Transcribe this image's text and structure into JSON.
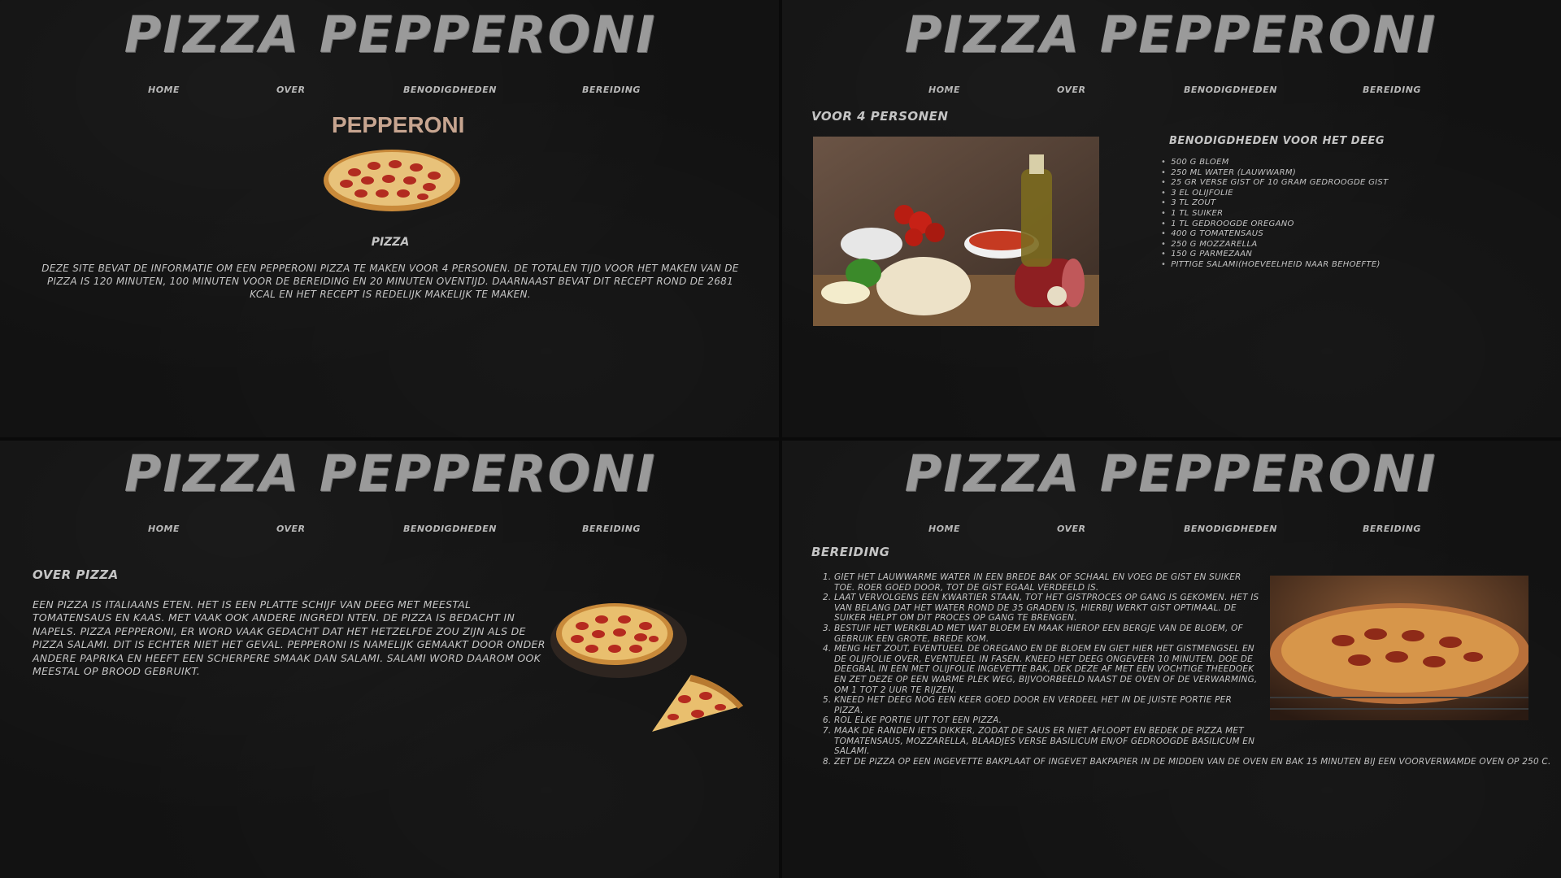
{
  "site": {
    "title": "PIZZA PEPPERONI",
    "nav": [
      "HOME",
      "OVER",
      "BENODIGDHEDEN",
      "BEREIDING"
    ]
  },
  "home": {
    "logo_text": "PEPPERONI",
    "caption": "PIZZA",
    "intro": "DEZE SITE BEVAT DE INFORMATIE OM EEN PEPPERONI PIZZA TE MAKEN VOOR 4 PERSONEN. DE TOTALEN TIJD VOOR HET MAKEN VAN DE PIZZA IS 120 MINUTEN, 100 MINUTEN VOOR DE BEREIDING EN 20 MINUTEN OVENTIJD. DAARNAAST BEVAT DIT RECEPT ROND DE 2681 KCAL EN HET RECEPT IS REDELIJK MAKELIJK TE MAKEN."
  },
  "benodigdheden": {
    "persons": "VOOR 4 PERSONEN",
    "list_title": "BENODIGDHEDEN VOOR HET DEEG",
    "items": [
      "500 G BLOEM",
      "250 ML WATER (LAUWWARM)",
      "25 GR VERSE GIST OF 10 GRAM GEDROOGDE GIST",
      "3 EL OLIJFOLIE",
      "3 TL ZOUT",
      "1 TL SUIKER",
      "1 TL GEDROOGDE OREGANO",
      "400 G TOMATENSAUS",
      "250 G MOZZARELLA",
      "150 G PARMEZAAN",
      "PITTIGE SALAMI(HOEVEELHEID NAAR BEHOEFTE)"
    ]
  },
  "over": {
    "heading": "OVER PIZZA",
    "text": "EEN PIZZA IS ITALIAANS ETEN. HET IS EEN PLATTE SCHIJF VAN DEEG MET MEESTAL TOMATENSAUS EN KAAS. MET VAAK OOK ANDERE INGREDI NTEN. DE PIZZA IS BEDACHT IN NAPELS. PIZZA PEPPERONI, ER WORD VAAK GEDACHT DAT HET HETZELFDE ZOU ZIJN ALS DE PIZZA SALAMI. DIT IS ECHTER NIET HET GEVAL. PEPPERONI IS NAMELIJK GEMAAKT DOOR ONDER ANDERE PAPRIKA EN HEEFT EEN SCHERPERE SMAAK DAN SALAMI. SALAMI WORD DAAROM OOK MEESTAL OP BROOD GEBRUIKT."
  },
  "bereiding": {
    "heading": "BEREIDING",
    "steps": [
      "GIET HET LAUWWARME WATER IN EEN BREDE BAK OF SCHAAL EN VOEG DE GIST EN SUIKER TOE. ROER GOED DOOR, TOT DE GIST EGAAL VERDEELD IS.",
      "LAAT VERVOLGENS EEN KWARTIER STAAN, TOT HET GISTPROCES OP GANG IS GEKOMEN. HET IS VAN BELANG DAT HET WATER ROND DE 35 GRADEN IS, HIERBIJ WERKT GIST OPTIMAAL. DE SUIKER HELPT OM DIT PROCES OP GANG TE BRENGEN.",
      "BESTUIF HET WERKBLAD MET WAT BLOEM EN MAAK HIEROP EEN BERGJE VAN DE BLOEM, OF GEBRUIK EEN GROTE, BREDE KOM.",
      "MENG HET ZOUT, EVENTUEEL DE OREGANO EN DE BLOEM EN GIET HIER HET GISTMENGSEL EN DE OLIJFOLIE OVER, EVENTUEEL IN FASEN. KNEED HET DEEG ONGEVEER 10 MINUTEN. DOE DE DEEGBAL IN EEN MET OLIJFOLIE INGEVETTE BAK, DEK DEZE AF MET EEN VOCHTIGE THEEDOEK EN ZET DEZE OP EEN WARME PLEK WEG, BIJVOORBEELD NAAST DE OVEN OF DE VERWARMING, OM 1 TOT 2 UUR TE RIJZEN.",
      "KNEED HET DEEG NOG EEN KEER GOED DOOR EN VERDEEL HET IN DE JUISTE PORTIE PER PIZZA.",
      "ROL ELKE PORTIE UIT TOT EEN PIZZA.",
      "MAAK DE RANDEN IETS DIKKER, ZODAT DE SAUS ER NIET AFLOOPT EN BEDEK DE PIZZA MET TOMATENSAUS, MOZZARELLA, BLAADJES VERSE BASILICUM EN/OF GEDROOGDE BASILICUM EN SALAMI.",
      "ZET DE PIZZA OP EEN INGEVETTE BAKPLAAT OF INGEVET BAKPAPIER IN DE MIDDEN VAN DE OVEN EN BAK 15 MINUTEN BIJ EEN VOORVERWAMDE OVEN OP 250  C."
    ]
  },
  "colors": {
    "background": "#121212",
    "title": "#9a9a9a",
    "text": "#c6c6c6",
    "logo": "#c7a590"
  }
}
